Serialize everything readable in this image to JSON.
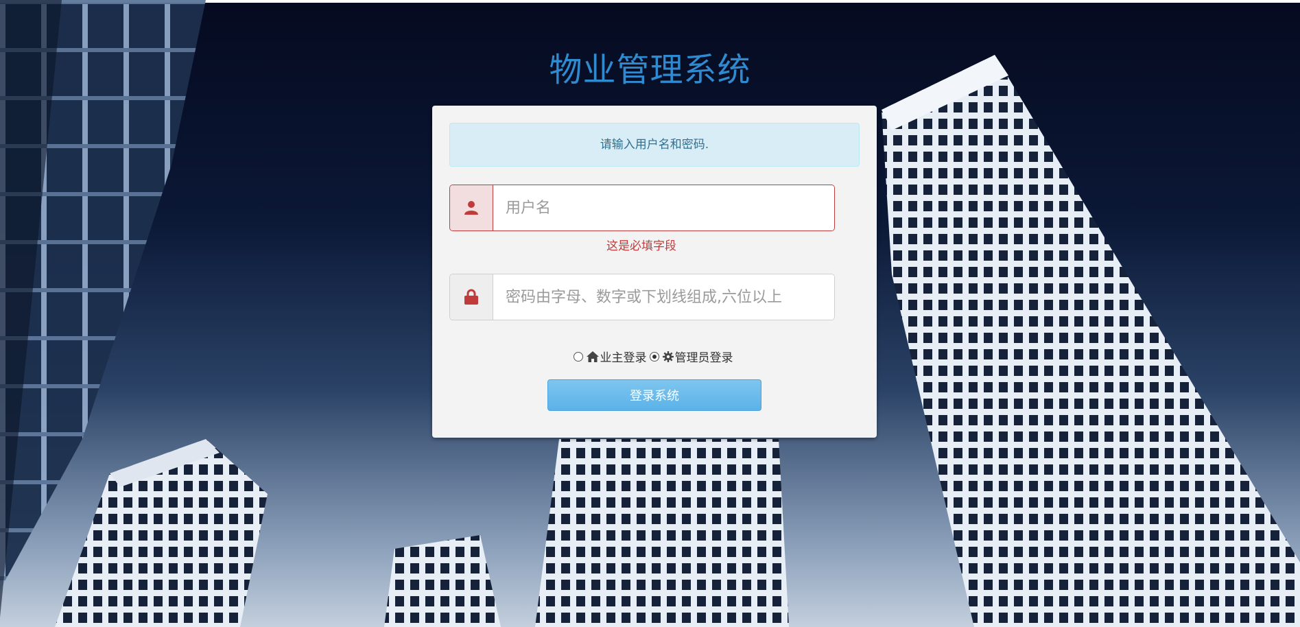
{
  "header": {
    "title": "物业管理系统"
  },
  "login_panel": {
    "alert_message": "请输入用户名和密码.",
    "username": {
      "placeholder": "用户名",
      "value": "",
      "icon": "user-icon",
      "error": "这是必填字段"
    },
    "password": {
      "placeholder": "密码由字母、数字或下划线组成,六位以上",
      "value": "",
      "icon": "lock-icon"
    },
    "roles": [
      {
        "label": "业主登录",
        "icon": "home-icon",
        "selected": false
      },
      {
        "label": "管理员登录",
        "icon": "gear-icon",
        "selected": true
      }
    ],
    "submit_label": "登录系统"
  },
  "colors": {
    "title": "#2f8ad0",
    "alert_bg": "#d9edf7",
    "alert_text": "#31708f",
    "error": "#c03b3b",
    "button": "#5bb2e8"
  }
}
